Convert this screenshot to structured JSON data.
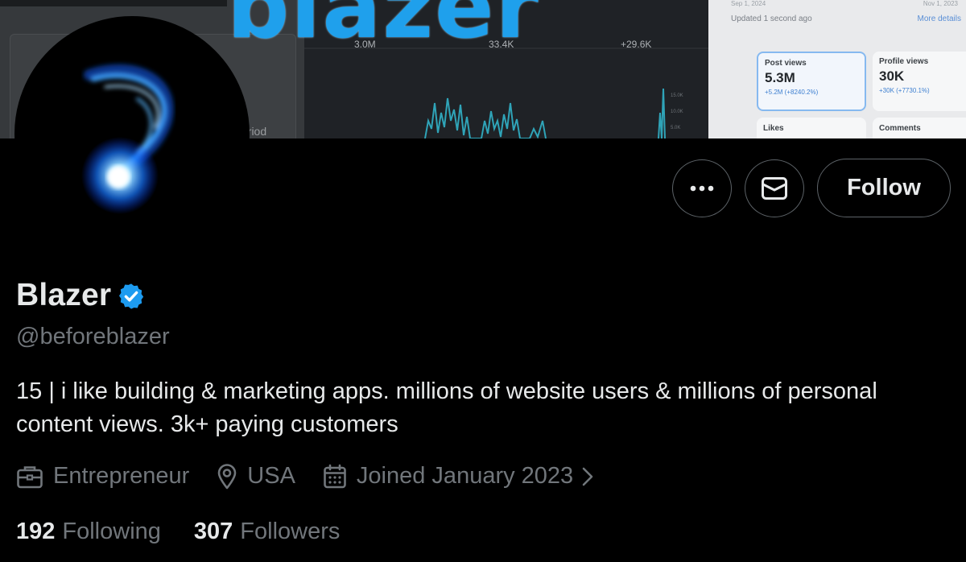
{
  "banner": {
    "period_text": "eriod",
    "stats": [
      "3.0M",
      "33.4K",
      "+29.6K"
    ],
    "logo_text": "blazer",
    "updated_text": "Updated 1 second ago",
    "more_details": "More details",
    "date_left": "Sep 1, 2024",
    "date_right": "Nov 1, 2023",
    "metrics": [
      {
        "label": "Post views",
        "value": "5.3M",
        "delta": "+5.2M (+8240.2%)"
      },
      {
        "label": "Profile views",
        "value": "30K",
        "delta": "+30K (+7730.1%)"
      }
    ],
    "metrics2": [
      "Likes",
      "Comments"
    ],
    "accent": "#1fa0ec"
  },
  "profile": {
    "name": "Blazer",
    "handle": "@beforeblazer",
    "bio_line1": "15 | i like building & marketing apps. millions of website users & millions of personal",
    "bio_line2": "content views. 3k+ paying customers",
    "occupation": "Entrepreneur",
    "location": "USA",
    "joined": "Joined January 2023",
    "following_count": "192",
    "following_label": "Following",
    "followers_count": "307",
    "followers_label": "Followers"
  },
  "actions": {
    "follow_label": "Follow",
    "more_icon": "more-icon",
    "message_icon": "mail-icon"
  },
  "colors": {
    "background": "#000000",
    "primary_text": "#e7e9ea",
    "secondary_text": "#71767b",
    "verified_blue": "#1d9bf0"
  }
}
